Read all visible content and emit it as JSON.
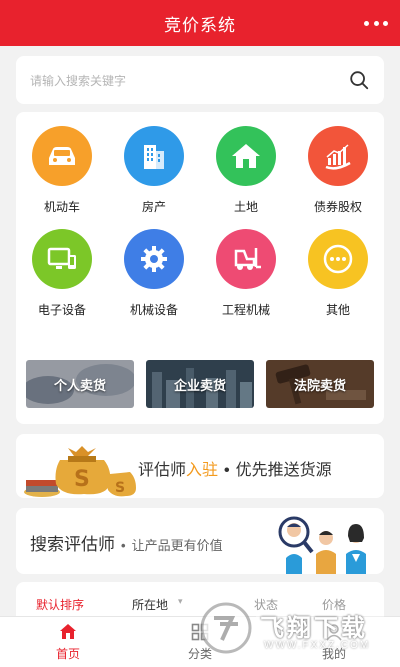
{
  "header": {
    "title": "竞价系统",
    "more_icon": "more-dots-icon"
  },
  "search": {
    "placeholder": "请输入搜索关键字",
    "icon": "search-icon"
  },
  "categories": [
    {
      "label": "机动车",
      "icon": "car-icon",
      "color": "#f7a02a"
    },
    {
      "label": "房产",
      "icon": "building-icon",
      "color": "#2f9ae8"
    },
    {
      "label": "土地",
      "icon": "house-icon",
      "color": "#33c25a"
    },
    {
      "label": "债券股权",
      "icon": "stock-chart-icon",
      "color": "#f2553a"
    },
    {
      "label": "电子设备",
      "icon": "monitor-phone-icon",
      "color": "#7cc728"
    },
    {
      "label": "机械设备",
      "icon": "gear-icon",
      "color": "#3f7ee6"
    },
    {
      "label": "工程机械",
      "icon": "forklift-icon",
      "color": "#ee4b73"
    },
    {
      "label": "其他",
      "icon": "ellipsis-icon",
      "color": "#f7c322"
    }
  ],
  "sellers": [
    {
      "label": "个人卖货"
    },
    {
      "label": "企业卖货"
    },
    {
      "label": "法院卖货"
    }
  ],
  "banner_appraiser": {
    "part1": "评估师",
    "part2": "入驻",
    "sep": "•",
    "part3": "优先推送货源"
  },
  "banner_search": {
    "part1": "搜索",
    "part2": "评估师",
    "sep": "•",
    "part3": "让产品更有价值"
  },
  "sort": {
    "default": "默认排序",
    "location": "所在地",
    "partial1": "状态",
    "partial2": "价格"
  },
  "tabbar": [
    {
      "label": "首页",
      "icon": "home-icon",
      "active": true
    },
    {
      "label": "分类",
      "icon": "category-grid-icon",
      "active": false
    },
    {
      "label": "我的",
      "icon": "user-icon",
      "active": false
    }
  ],
  "watermark": {
    "text": "飞翔下载",
    "url": "WWW.FXXZ.COM"
  },
  "colors": {
    "brand_red": "#e8222d",
    "accent_orange": "#f39a1e",
    "accent_blue": "#2a8fd4"
  }
}
